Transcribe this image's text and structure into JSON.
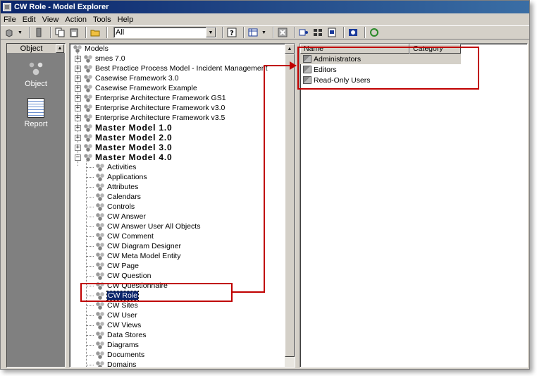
{
  "window": {
    "title": "CW Role - Model Explorer"
  },
  "menu": [
    "File",
    "Edit",
    "View",
    "Action",
    "Tools",
    "Help"
  ],
  "toolbar": {
    "filter_value": "All"
  },
  "object_bar": {
    "header": "Object",
    "items": [
      {
        "label": "Object",
        "icon": "object-cubes-icon"
      },
      {
        "label": "Report",
        "icon": "report-icon"
      }
    ]
  },
  "tree": {
    "root": "Models",
    "models": [
      "smes 7.0",
      "Best Practice Process Model - Incident Management",
      "Casewise Framework 3.0",
      "Casewise Framework Example",
      "Enterprise Architecture Framework GS1",
      "Enterprise Architecture Framework v3.0",
      "Enterprise Architecture Framework v3.5",
      "Master Model 1.0",
      "Master Model 2.0",
      "Master Model 3.0",
      "Master Model 4.0"
    ],
    "children": [
      "Activities",
      "Applications",
      "Attributes",
      "Calendars",
      "Controls",
      "CW Answer",
      "CW Answer User All Objects",
      "CW Comment",
      "CW Diagram Designer",
      "CW Meta Model Entity",
      "CW Page",
      "CW Question",
      "CW Questionnaire",
      "CW Role",
      "CW Sites",
      "CW User",
      "CW Views",
      "Data Stores",
      "Diagrams",
      "Documents",
      "Domains"
    ],
    "selected": "CW Role"
  },
  "list": {
    "columns": [
      "Name",
      "Category"
    ],
    "rows": [
      "Administrators",
      "Editors",
      "Read-Only Users"
    ]
  },
  "annotation_color": "#c00000"
}
